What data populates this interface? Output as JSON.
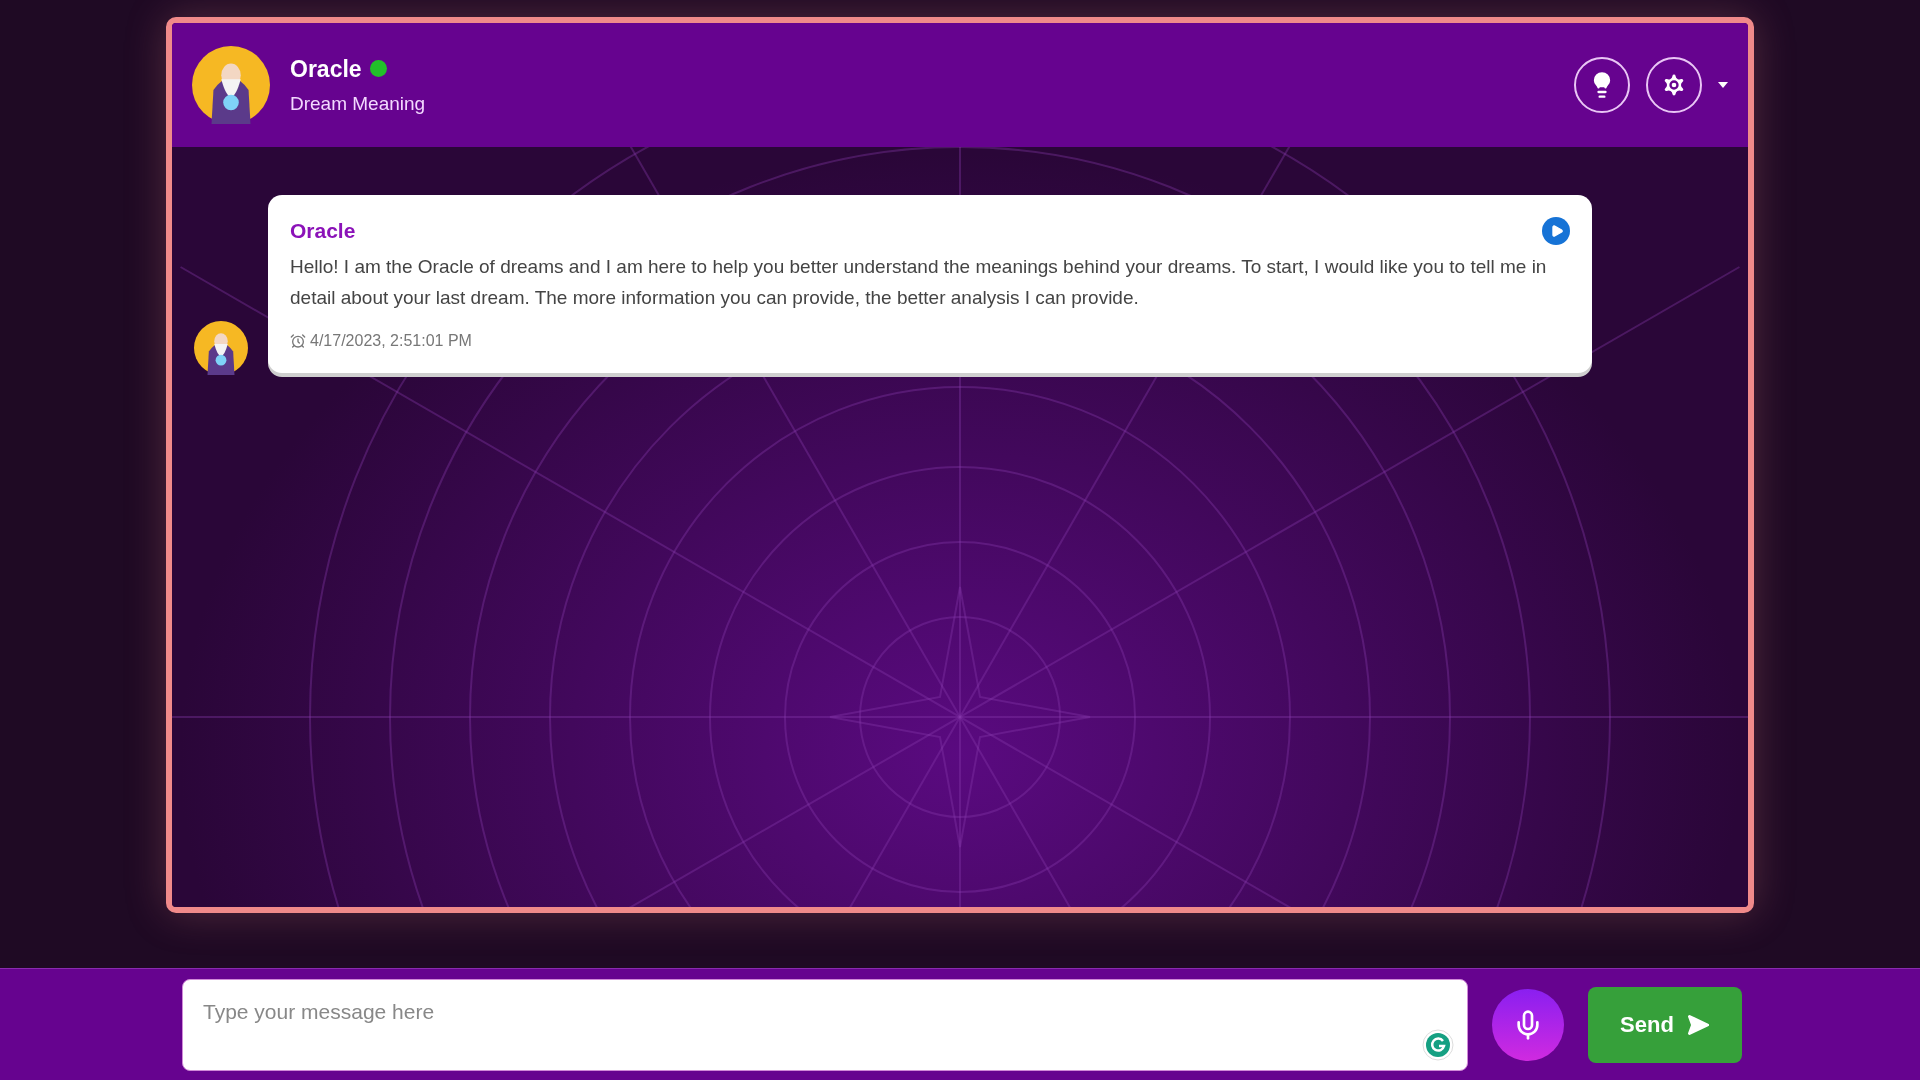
{
  "header": {
    "name": "Oracle",
    "online": true,
    "subtitle": "Dream Meaning"
  },
  "messages": [
    {
      "sender": "Oracle",
      "text": "Hello! I am the Oracle of dreams and I am here to help you better understand the meanings behind your dreams. To start, I would like you to tell me in detail about your last dream. The more information you can provide, the better analysis I can provide.",
      "timestamp": "4/17/2023, 2:51:01 PM"
    }
  ],
  "composer": {
    "placeholder": "Type your message here",
    "send_label": "Send"
  }
}
